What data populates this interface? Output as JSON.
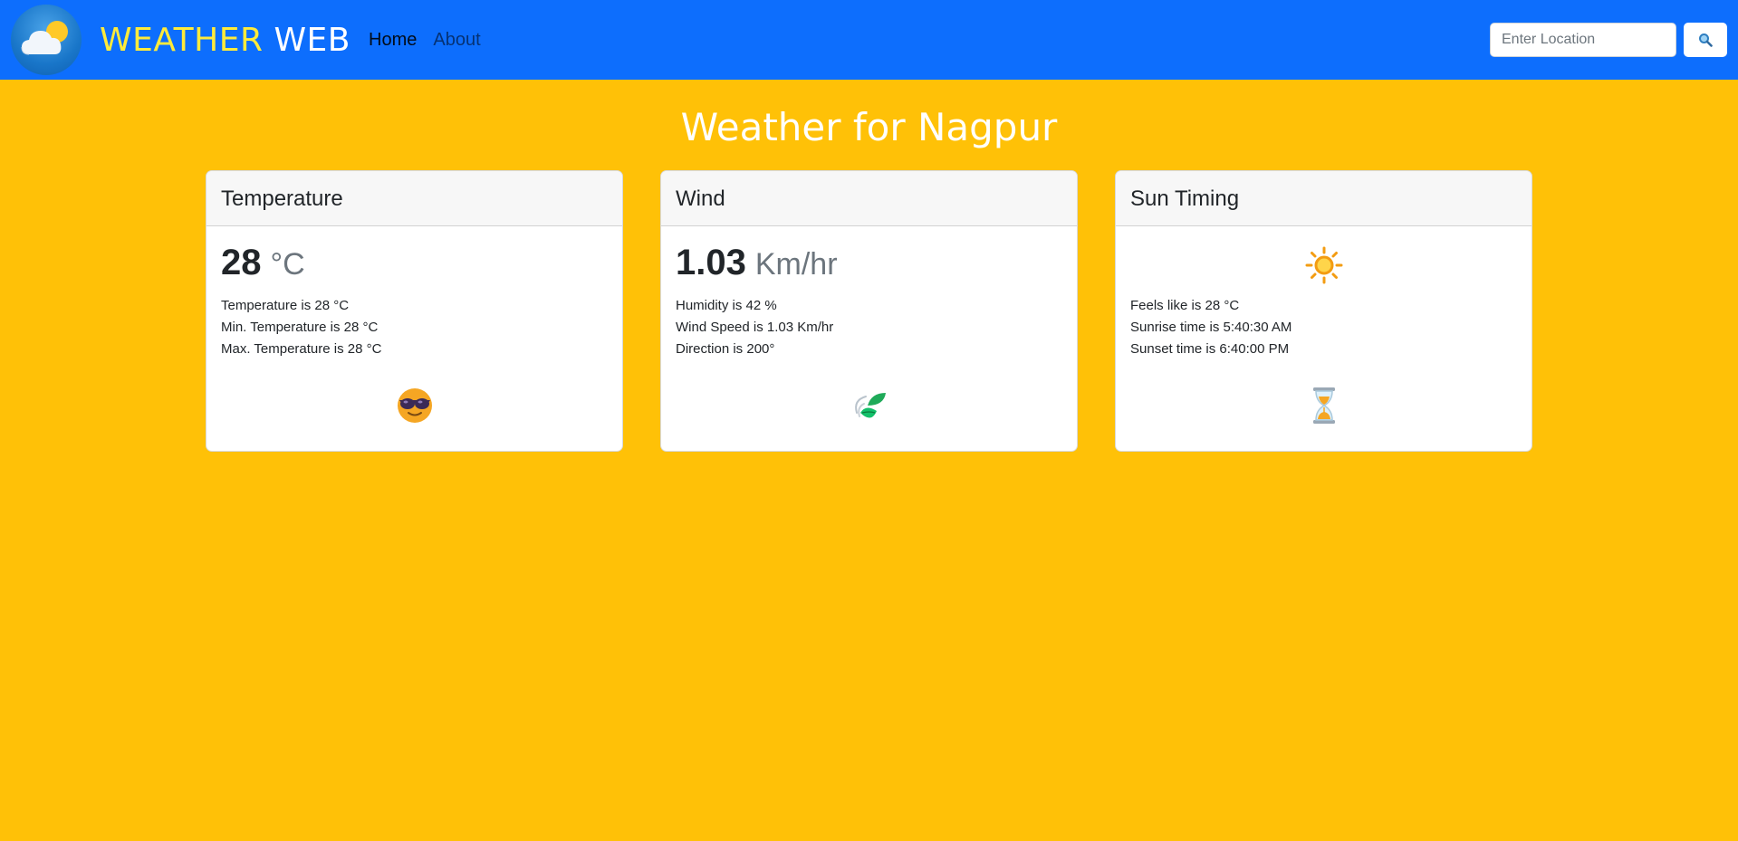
{
  "navbar": {
    "brand_part1": "WEATHER",
    "brand_part2": "WEB",
    "links": [
      {
        "label": "Home",
        "active": true
      },
      {
        "label": "About",
        "active": false
      }
    ],
    "search": {
      "placeholder": "Enter Location",
      "value": ""
    },
    "logo_icon": "cloud-sun-icon",
    "search_icon": "magnifier-icon"
  },
  "page": {
    "title": "Weather for Nagpur"
  },
  "cards": {
    "temperature": {
      "header": "Temperature",
      "value": "28",
      "unit": "°C",
      "lines": [
        "Temperature is 28 °C",
        "Min. Temperature is 28 °C",
        "Max. Temperature is 28 °C"
      ],
      "icon": "sunglasses-face-icon"
    },
    "wind": {
      "header": "Wind",
      "value": "1.03",
      "unit": "Km/hr",
      "lines": [
        "Humidity is 42 %",
        "Wind Speed is 1.03 Km/hr",
        "Direction is 200°"
      ],
      "icon": "leaf-wind-icon"
    },
    "sun": {
      "header": "Sun Timing",
      "top_icon": "sun-icon",
      "lines": [
        "Feels like is 28 °C",
        "Sunrise time is 5:40:30 AM",
        "Sunset time is 6:40:00 PM"
      ],
      "icon": "hourglass-icon"
    }
  },
  "colors": {
    "navbar": "#0d6efd",
    "background": "#ffc107",
    "brand_accent": "#ffeb3b"
  }
}
